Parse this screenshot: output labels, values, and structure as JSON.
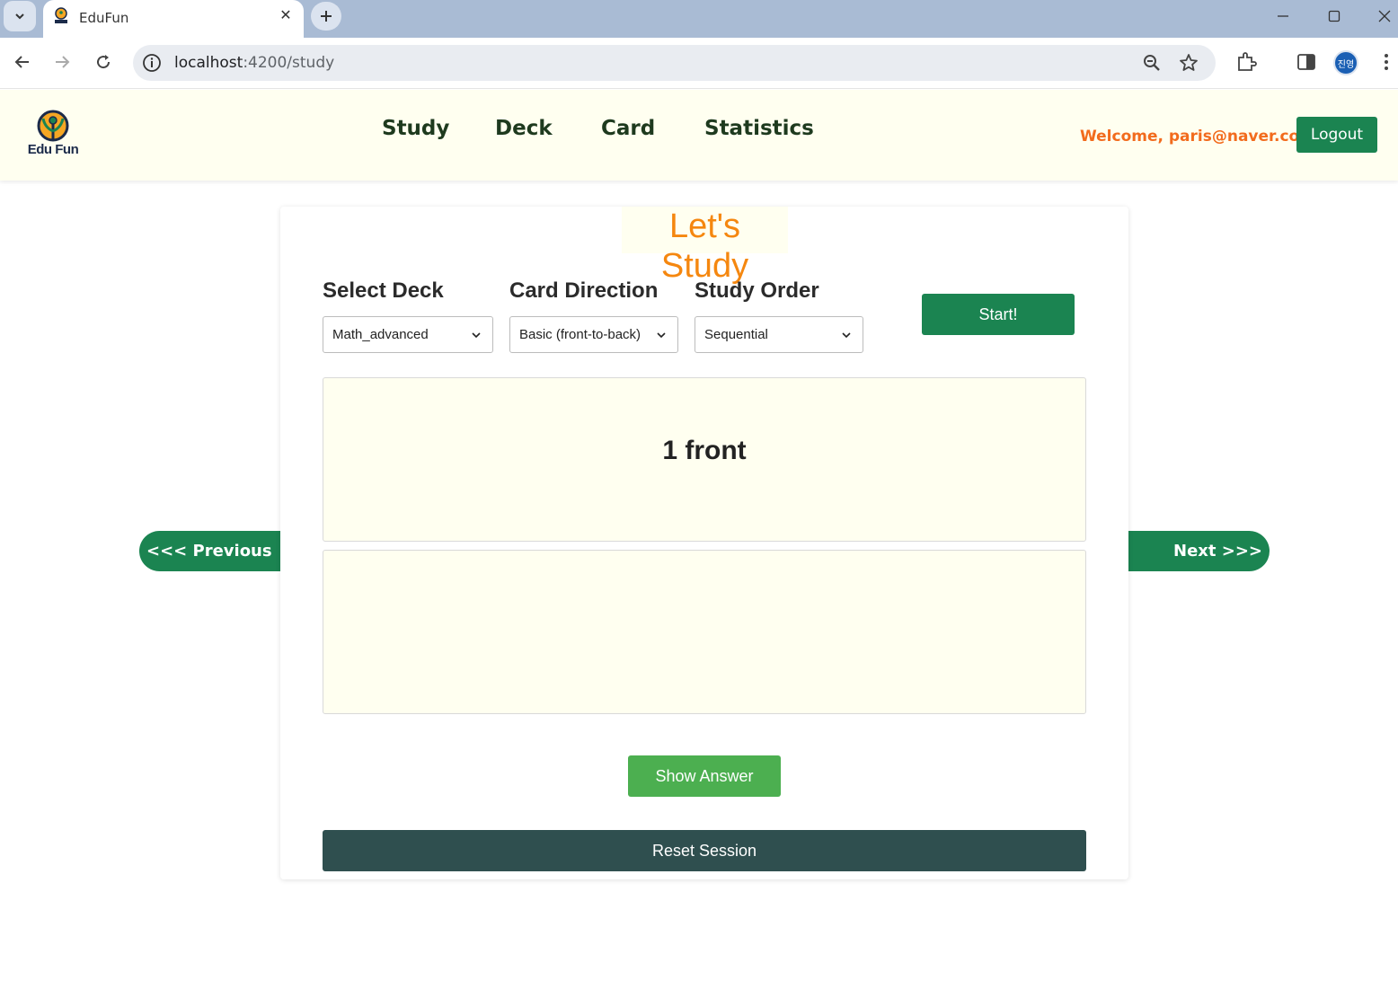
{
  "browser": {
    "tab_title": "EduFun",
    "url_host": "localhost",
    "url_path": ":4200/study",
    "profile_initials": "진영"
  },
  "header": {
    "logo_text": "Edu Fun",
    "nav": [
      {
        "label": "Study"
      },
      {
        "label": "Deck"
      },
      {
        "label": "Card"
      },
      {
        "label": "Statistics"
      }
    ],
    "welcome": "Welcome, paris@naver.com!",
    "logout_label": "Logout"
  },
  "study": {
    "title": "Let's Study",
    "deck_label": "Select Deck",
    "deck_value": "Math_advanced",
    "direction_label": "Card Direction",
    "direction_value": "Basic (front-to-back)",
    "order_label": "Study Order",
    "order_value": "Sequential",
    "start_label": "Start!",
    "front_text": "1 front",
    "back_text": "",
    "show_answer_label": "Show Answer",
    "reset_label": "Reset Session",
    "previous_label": "<<< Previous",
    "next_label": "Next >>>"
  },
  "colors": {
    "brand_green": "#1b8451",
    "answer_green": "#4caf50",
    "reset_dark": "#2f4f4f",
    "title_orange": "#f5870f",
    "welcome_orange": "#f26b1d",
    "header_bg": "#fffff0"
  }
}
